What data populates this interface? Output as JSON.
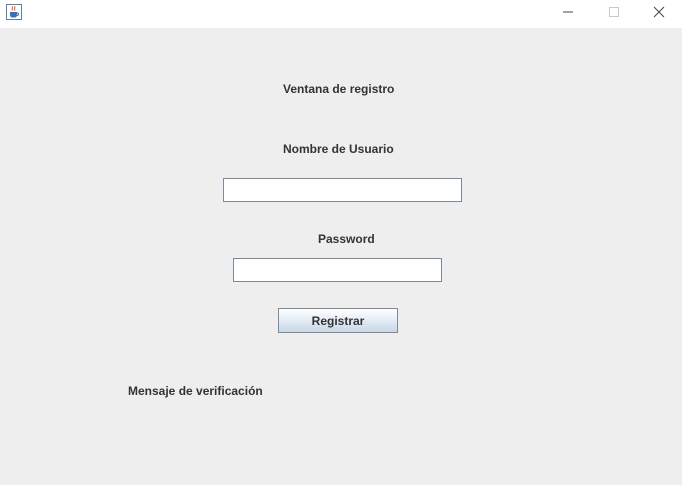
{
  "titlebar": {
    "app_icon": "java-cup-icon",
    "controls": {
      "minimize_icon": "minimize-icon",
      "maximize_icon": "maximize-icon",
      "close_icon": "close-icon"
    }
  },
  "form": {
    "title": "Ventana de registro",
    "username_label": "Nombre de Usuario",
    "username_value": "",
    "password_label": "Password",
    "password_value": "",
    "register_button": "Registrar",
    "verification_message": "Mensaje de verificación"
  },
  "colors": {
    "background": "#eeeeee",
    "titlebar": "#ffffff",
    "label_text": "#333333",
    "field_border": "#7a8a99"
  }
}
